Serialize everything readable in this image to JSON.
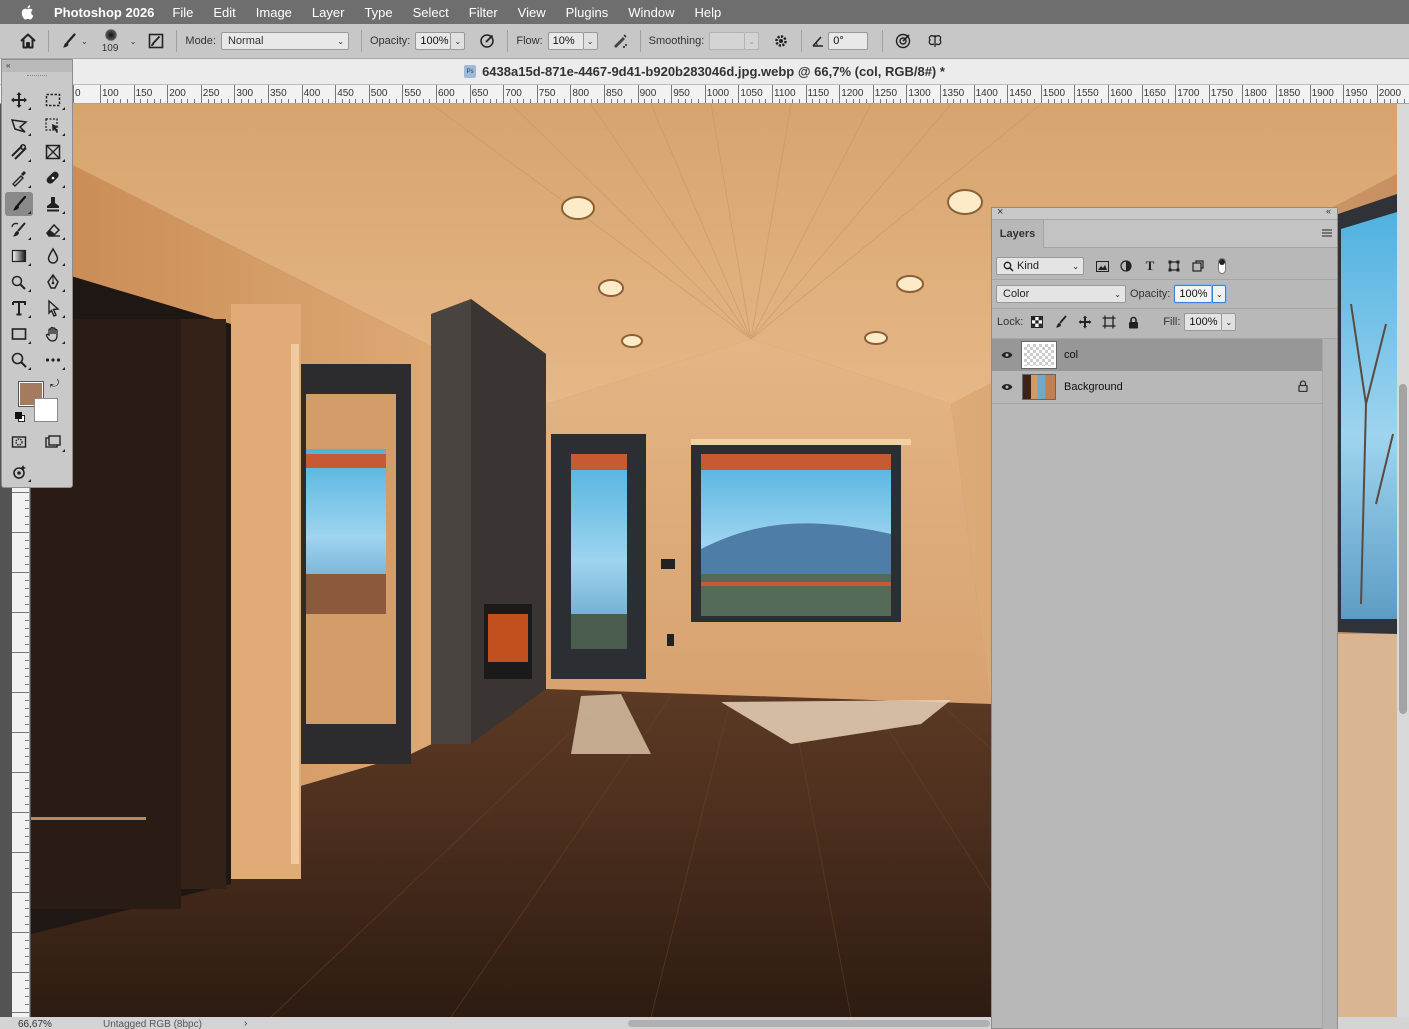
{
  "menubar": {
    "app_name": "Photoshop 2026",
    "items": [
      "File",
      "Edit",
      "Image",
      "Layer",
      "Type",
      "Select",
      "Filter",
      "View",
      "Plugins",
      "Window",
      "Help"
    ]
  },
  "options_bar": {
    "brush_size": "109",
    "mode_label": "Mode:",
    "mode_value": "Normal",
    "opacity_label": "Opacity:",
    "opacity_value": "100%",
    "flow_label": "Flow:",
    "flow_value": "10%",
    "smoothing_label": "Smoothing:",
    "smoothing_value": "",
    "angle_value": "0°"
  },
  "document": {
    "title": "6438a15d-871e-4467-9d41-b920b283046d.jpg.webp @ 66,7% (col, RGB/8#) *",
    "doc_icon_label": "Ps"
  },
  "ruler": {
    "h_labels": [
      "0",
      "100",
      "150",
      "200",
      "250",
      "300",
      "350",
      "400",
      "450",
      "500",
      "550",
      "600",
      "650",
      "700",
      "750",
      "800",
      "850",
      "900",
      "950",
      "1000",
      "1050",
      "1100",
      "1150",
      "1200",
      "1250",
      "1300",
      "1350",
      "1400",
      "1450",
      "1500",
      "1550",
      "1600",
      "1650",
      "1700",
      "1750",
      "1800",
      "1850",
      "1900",
      "1950",
      "2000"
    ]
  },
  "tools_panel": {
    "collapse_label": "«",
    "tools": [
      "move-tool",
      "rectangular-marquee-tool",
      "lasso-tool",
      "object-selection-tool",
      "crop-tool",
      "frame-tool",
      "eyedropper-tool",
      "spot-healing-brush-tool",
      "brush-tool",
      "clone-stamp-tool",
      "history-brush-tool",
      "eraser-tool",
      "gradient-tool",
      "blur-tool",
      "dodge-tool",
      "pen-tool",
      "type-tool",
      "path-selection-tool",
      "rectangle-tool",
      "hand-tool",
      "zoom-tool",
      "edit-toolbar"
    ],
    "active_tool": "brush-tool",
    "foreground_color": "#a57a5e",
    "background_color": "#ffffff"
  },
  "layers_panel": {
    "tab_label": "Layers",
    "filter_label": "Kind",
    "blend_mode": "Color",
    "opacity_label": "Opacity:",
    "opacity_value": "100%",
    "lock_label": "Lock:",
    "fill_label": "Fill:",
    "fill_value": "100%",
    "layers": [
      {
        "name": "col",
        "selected": true,
        "visible": true,
        "locked": false
      },
      {
        "name": "Background",
        "selected": false,
        "visible": true,
        "locked": true
      }
    ]
  },
  "status_bar": {
    "zoom": "66,67%",
    "profile": "Untagged RGB (8bpc)",
    "arrow": "›"
  }
}
